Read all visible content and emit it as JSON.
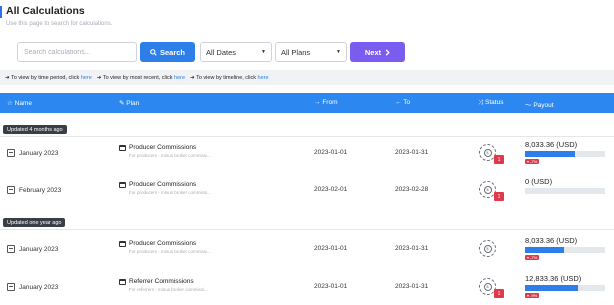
{
  "header": {
    "title": "All Calculations",
    "subtitle": "Use this page to search for calculations."
  },
  "toolbar": {
    "search_placeholder": "Search calculations...",
    "search_label": "Search",
    "dates_value": "All Dates",
    "plans_value": "All Plans",
    "next_label": "Next"
  },
  "hints": [
    {
      "text": "To view by time period, click ",
      "link": "here"
    },
    {
      "text": "To view by most recent, click ",
      "link": "here"
    },
    {
      "text": "To view by timeline, click ",
      "link": "here"
    }
  ],
  "table": {
    "columns": {
      "name": "Name",
      "plan": "Plan",
      "from": "From",
      "to": "To",
      "status": "Status",
      "payout": "Payout"
    },
    "groups": [
      {
        "label": "Updated 4 months ago"
      },
      {
        "label": "Updated one year ago"
      }
    ],
    "rows": [
      {
        "name": "January 2023",
        "plan": "Producer Commissions",
        "plan_desc": "For producers - minus broker commissi...",
        "from": "2023-01-01",
        "to": "2023-01-31",
        "status_count": "1",
        "payout": "8,033.36 (USD)",
        "payout_fill": 0.62,
        "change": "▾ -7%"
      },
      {
        "name": "February 2023",
        "plan": "Producer Commissions",
        "plan_desc": "For producers - minus broker commissi...",
        "from": "2023-02-01",
        "to": "2023-02-28",
        "status_count": "1",
        "payout": "0 (USD)",
        "payout_fill": 0.0,
        "change": ""
      },
      {
        "name": "January 2023",
        "plan": "Producer Commissions",
        "plan_desc": "For producers - minus broker commissi...",
        "from": "2023-01-01",
        "to": "2023-01-31",
        "status_count": "",
        "payout": "8,033.36 (USD)",
        "payout_fill": 0.49,
        "change": "▾ -7%"
      },
      {
        "name": "January 2023",
        "plan": "Referrer Commissions",
        "plan_desc": "For referrers - minus broker commissi...",
        "from": "2023-01-01",
        "to": "2023-01-31",
        "status_count": "1",
        "payout": "12,833.36 (USD)",
        "payout_fill": 0.66,
        "change": "▾ -9%"
      }
    ]
  },
  "colors": {
    "accent": "#2d7ee8",
    "header_bg": "#2d87f0",
    "next_button": "#7b5cf0",
    "badge_red": "#e2384d"
  }
}
